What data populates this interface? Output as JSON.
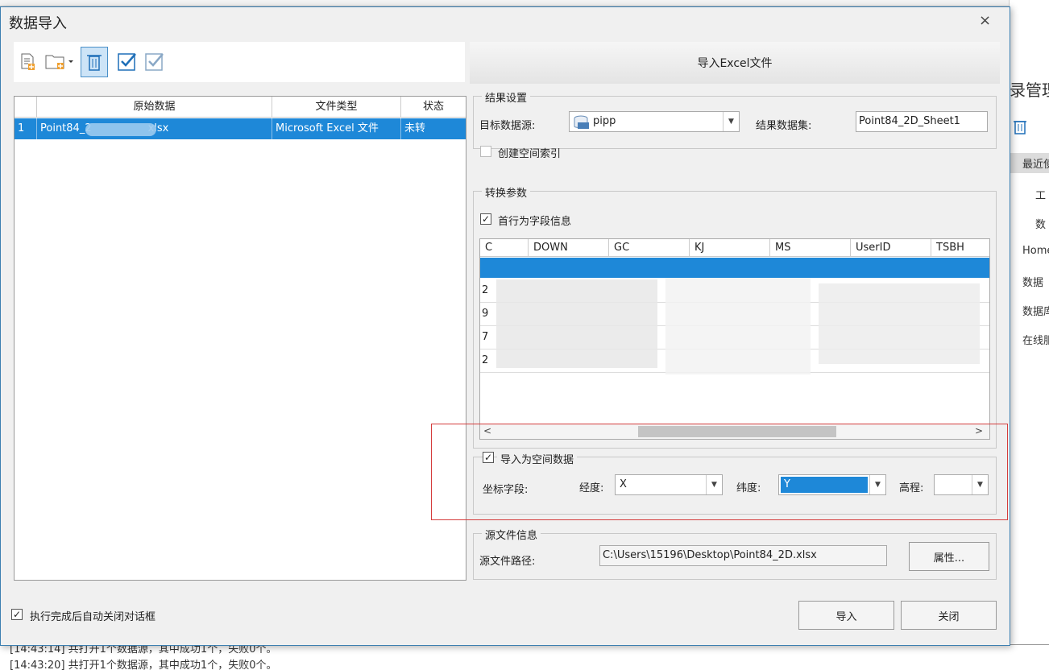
{
  "background": {
    "right_title": "录管理",
    "right_items": [
      "最近使",
      "工",
      "数",
      "Home",
      "数据",
      "数据库",
      "在线服"
    ],
    "log_lines": [
      "[14:43:14] 共打开1个数据源，其中成功1个，失败0个。",
      "[14:43:20] 共打开1个数据源，其中成功1个，失败0个。"
    ]
  },
  "dialog": {
    "title": "数据导入",
    "close_glyph": "×",
    "import_header": "导入Excel文件",
    "filelist": {
      "headers": [
        "原始数据",
        "文件类型",
        "状态"
      ],
      "row": {
        "index": "1",
        "name_start": "Point84_2",
        "name_end": "xlsx",
        "type": "Microsoft Excel 文件",
        "status": "未转"
      }
    },
    "result": {
      "title": "结果设置",
      "target_label": "目标数据源:",
      "target_value": "pipp",
      "dataset_label": "结果数据集:",
      "dataset_value": "Point84_2D_Sheet1",
      "spatial_index_label": "创建空间索引"
    },
    "convert": {
      "title": "转换参数",
      "first_row_label": "首行为字段信息",
      "columns": [
        "C",
        "DOWN",
        "GC",
        "KJ",
        "MS",
        "UserID",
        "TSBH"
      ],
      "row_starts": [
        "2",
        "9",
        "7",
        "2"
      ]
    },
    "spatial": {
      "label": "导入为空间数据",
      "coord_label": "坐标字段:",
      "lon_label": "经度:",
      "lon_value": "X",
      "lat_label": "纬度:",
      "lat_value": "Y",
      "elev_label": "高程:",
      "elev_value": ""
    },
    "source": {
      "title": "源文件信息",
      "path_label": "源文件路径:",
      "path_value": "C:\\Users\\15196\\Desktop\\Point84_2D.xlsx",
      "props_button": "属性..."
    },
    "auto_close_label": "执行完成后自动关闭对话框",
    "import_button": "导入",
    "close_button": "关闭"
  },
  "colors": {
    "selection": "#1e88d8",
    "highlight_box": "#d43c3c"
  }
}
